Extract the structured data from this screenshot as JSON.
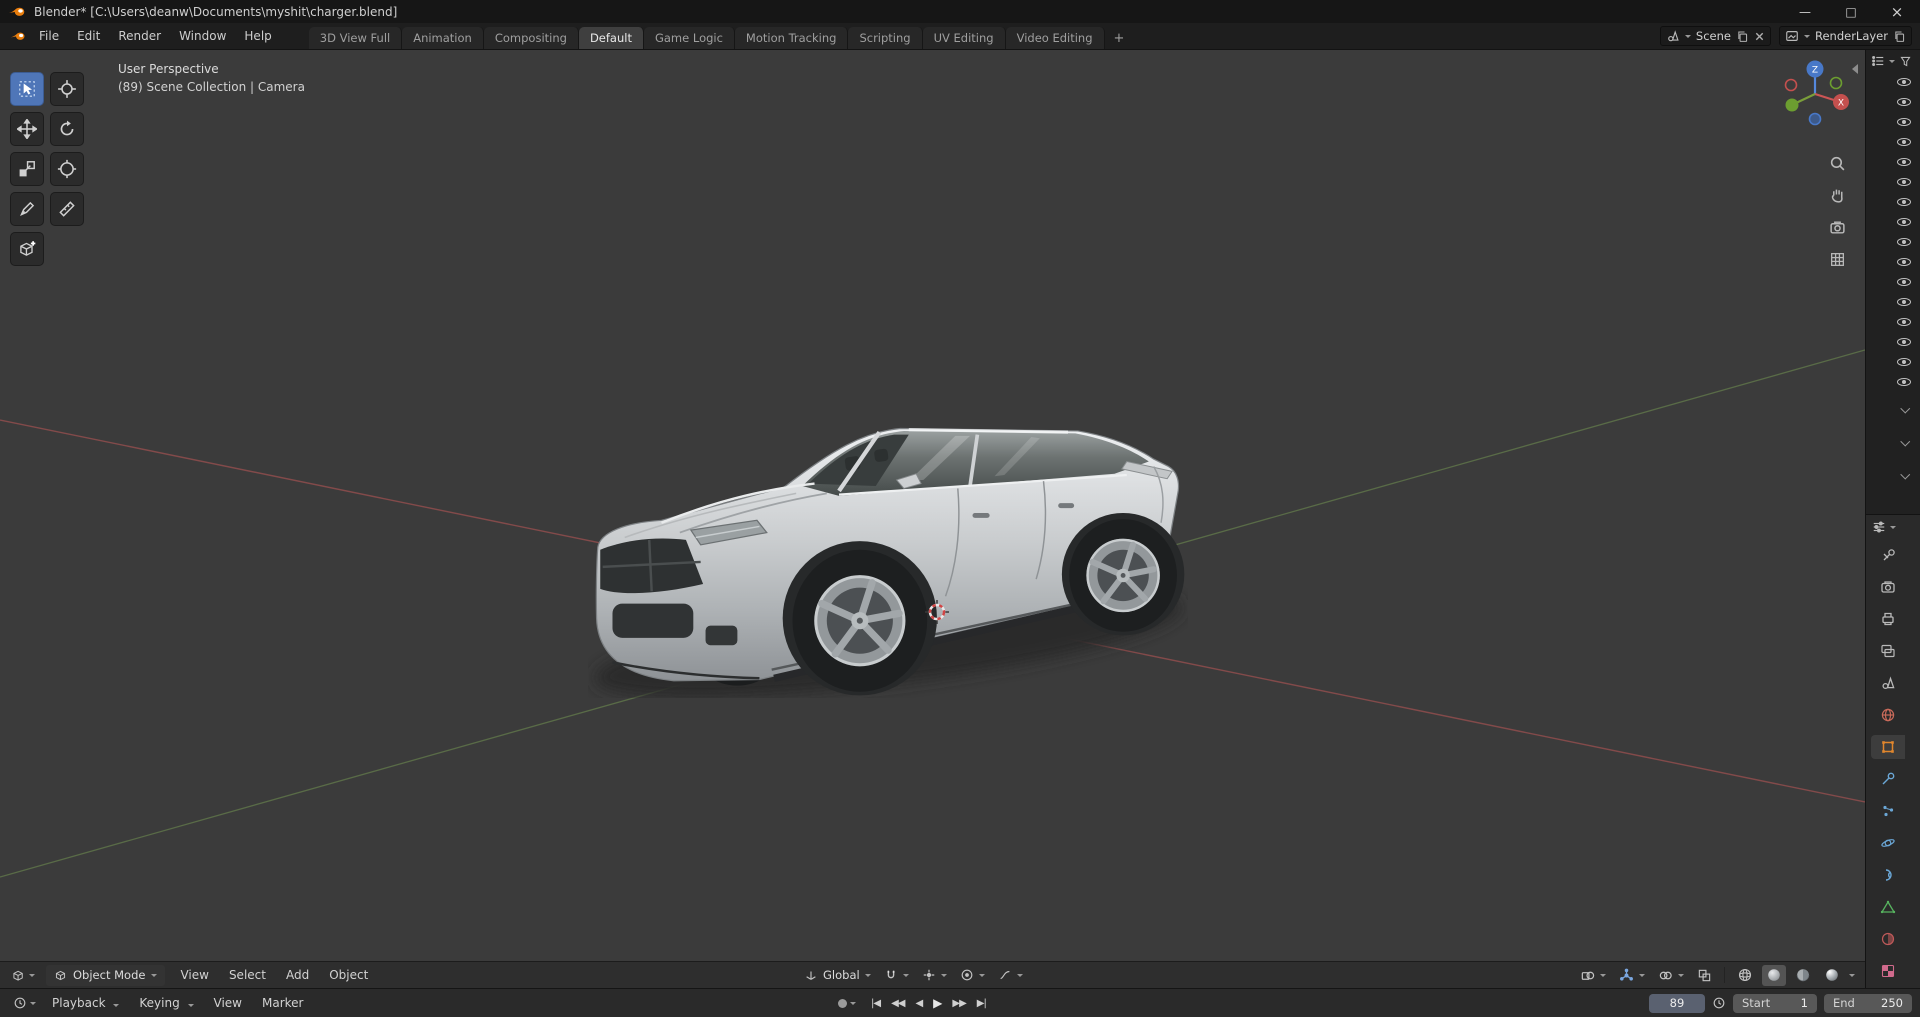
{
  "titlebar": {
    "title": "Blender* [C:\\Users\\deanw\\Documents\\myshit\\charger.blend]",
    "controls": {
      "minimize": "—",
      "maximize": "□",
      "close": "×"
    }
  },
  "topbar": {
    "menus": [
      "File",
      "Edit",
      "Render",
      "Window",
      "Help"
    ],
    "workspaces": [
      "3D View Full",
      "Animation",
      "Compositing",
      "Default",
      "Game Logic",
      "Motion Tracking",
      "Scripting",
      "UV Editing",
      "Video Editing"
    ],
    "active_workspace": "Default",
    "add_workspace": "+",
    "scene_value": "Scene",
    "layer_value": "RenderLayer"
  },
  "viewport": {
    "overlay_line1": "User Perspective",
    "overlay_line2": "(89) Scene Collection | Camera",
    "header": {
      "mode_label": "Object Mode",
      "menus": [
        "View",
        "Select",
        "Add",
        "Object"
      ],
      "orientation_label": "Global"
    },
    "toolbar_icons": [
      "select-box",
      "cursor-3d",
      "move",
      "rotate",
      "scale",
      "transform",
      "annotate",
      "measure",
      "add-cube"
    ],
    "nav_icons": [
      "zoom",
      "pan",
      "camera-view",
      "toggle-ortho"
    ],
    "shading_modes": [
      "wireframe",
      "solid",
      "material-preview",
      "rendered"
    ],
    "active_shading": "solid"
  },
  "outliner": {
    "visibility_rows": 16,
    "collapsed_rows": 3
  },
  "properties": {
    "tabs": [
      "active-tool",
      "render",
      "output",
      "view-layer",
      "scene",
      "world",
      "object",
      "modifiers",
      "particles",
      "physics",
      "constraints",
      "object-data",
      "material",
      "texture"
    ],
    "active_tab": "object"
  },
  "timeline": {
    "menus": [
      "Playback",
      "Keying",
      "View",
      "Marker"
    ],
    "transport": [
      "|◀",
      "◀◀",
      "◀",
      "▶",
      "▶▶",
      "▶|"
    ],
    "current_frame": "89",
    "start_label": "Start",
    "start_value": "1",
    "end_label": "End",
    "end_value": "250"
  },
  "colors": {
    "accent_blue": "#4f76b8",
    "object_orange": "#e0862d",
    "axis_x_red": "#9b5050",
    "axis_y_green": "#66804d",
    "viewport_bg": "#3b3b3b"
  }
}
